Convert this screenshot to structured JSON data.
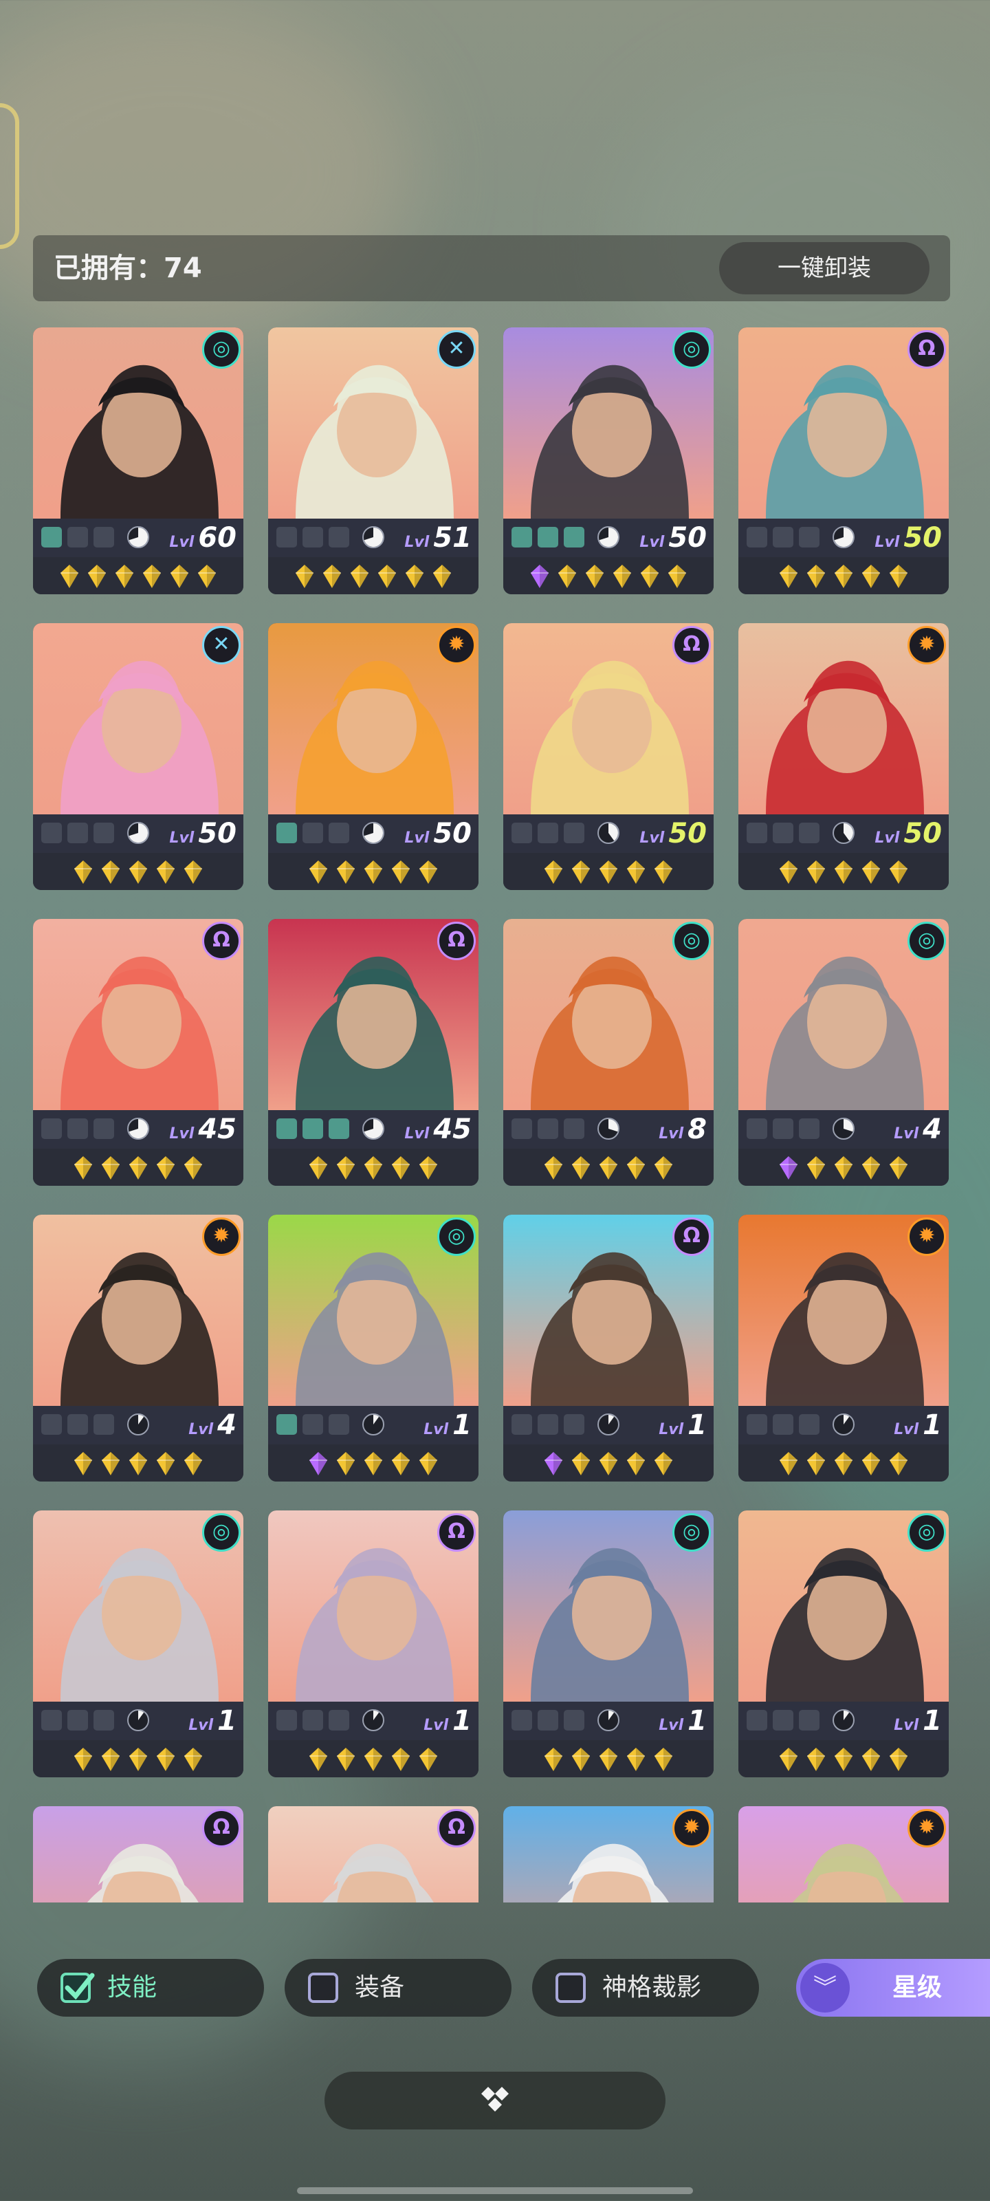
{
  "header": {
    "owned_label": "已拥有：74",
    "unequip_all": "一键卸装"
  },
  "colors": {
    "star_gold": "#f3c534",
    "star_purple": "#b86cff",
    "faction_teal": "#3fe0c8",
    "faction_purple": "#c58cff",
    "faction_orange": "#ff9c28",
    "faction_blue": "#7ad8f6"
  },
  "cards": [
    {
      "faction": "teal-swirl-icon",
      "level": "60",
      "slots_on": 1,
      "gear": 0.7,
      "stars": [
        "g",
        "g",
        "g",
        "g",
        "g",
        "g"
      ],
      "bg": "#e8a890",
      "art": "#1c1a1c"
    },
    {
      "faction": "blue-cross-icon",
      "level": "51",
      "slots_on": 0,
      "gear": 0.7,
      "stars": [
        "g",
        "g",
        "g",
        "g",
        "g",
        "g"
      ],
      "bg": "#f0c6a0",
      "art": "#e8ecd8"
    },
    {
      "faction": "teal-swirl-icon",
      "level": "50",
      "slots_on": 3,
      "gear": 0.7,
      "stars": [
        "p",
        "g",
        "g",
        "g",
        "g",
        "g"
      ],
      "bg": "#a88ce0",
      "art": "#3a3840"
    },
    {
      "faction": "purple-horn-icon",
      "level": "50",
      "slots_on": 0,
      "gear": 0.7,
      "stars": [
        "g",
        "g",
        "g",
        "g",
        "g"
      ],
      "bg": "#f0b08a",
      "art": "#5aa0a8",
      "max": true
    },
    {
      "faction": "blue-cross-icon",
      "level": "50",
      "slots_on": 0,
      "gear": 0.7,
      "stars": [
        "g",
        "g",
        "g",
        "g",
        "g"
      ],
      "bg": "#f2a890",
      "art": "#f0a0c8"
    },
    {
      "faction": "orange-gear-icon",
      "level": "50",
      "slots_on": 1,
      "gear": 0.7,
      "stars": [
        "g",
        "g",
        "g",
        "g",
        "g"
      ],
      "bg": "#e89a40",
      "art": "#f5a030"
    },
    {
      "faction": "purple-horn-icon",
      "level": "50",
      "slots_on": 0,
      "gear": 0.4,
      "stars": [
        "g",
        "g",
        "g",
        "g",
        "g"
      ],
      "bg": "#f2b890",
      "art": "#f0d888",
      "max": true
    },
    {
      "faction": "orange-gear-icon",
      "level": "50",
      "slots_on": 0,
      "gear": 0.4,
      "stars": [
        "g",
        "g",
        "g",
        "g",
        "g"
      ],
      "bg": "#e8c0a0",
      "art": "#c82a30",
      "max": true
    },
    {
      "faction": "purple-horn-icon",
      "level": "45",
      "slots_on": 0,
      "gear": 0.7,
      "stars": [
        "g",
        "g",
        "g",
        "g",
        "g"
      ],
      "bg": "#f2b0a0",
      "art": "#f06a5a"
    },
    {
      "faction": "purple-horn-icon",
      "level": "45",
      "slots_on": 3,
      "gear": 0.7,
      "stars": [
        "g",
        "g",
        "g",
        "g",
        "g"
      ],
      "bg": "#c83450",
      "art": "#2e5e5a"
    },
    {
      "faction": "teal-swirl-icon",
      "level": "8",
      "slots_on": 0,
      "gear": 0.3,
      "stars": [
        "g",
        "g",
        "g",
        "g",
        "g"
      ],
      "bg": "#e8b090",
      "art": "#d86a30"
    },
    {
      "faction": "teal-swirl-icon",
      "level": "4",
      "slots_on": 0,
      "gear": 0.3,
      "stars": [
        "p",
        "g",
        "g",
        "g",
        "g"
      ],
      "bg": "#f0a890",
      "art": "#8a8a90"
    },
    {
      "faction": "orange-gear-icon",
      "level": "4",
      "slots_on": 0,
      "gear": 0.1,
      "stars": [
        "g",
        "g",
        "g",
        "g",
        "g"
      ],
      "bg": "#f0c0a0",
      "art": "#2a2420"
    },
    {
      "faction": "teal-swirl-icon",
      "level": "1",
      "slots_on": 1,
      "gear": 0.1,
      "stars": [
        "p",
        "g",
        "g",
        "g",
        "g"
      ],
      "bg": "#9ad848",
      "art": "#8a8fa0"
    },
    {
      "faction": "purple-horn-icon",
      "level": "1",
      "slots_on": 0,
      "gear": 0.1,
      "stars": [
        "p",
        "g",
        "g",
        "g",
        "g"
      ],
      "bg": "#60d0e8",
      "art": "#4a3a30"
    },
    {
      "faction": "orange-gear-icon",
      "level": "1",
      "slots_on": 0,
      "gear": 0.1,
      "stars": [
        "g",
        "g",
        "g",
        "g",
        "g"
      ],
      "bg": "#e87830",
      "art": "#3a3030"
    },
    {
      "faction": "teal-swirl-icon",
      "level": "1",
      "slots_on": 0,
      "gear": 0.1,
      "stars": [
        "g",
        "g",
        "g",
        "g",
        "g"
      ],
      "bg": "#eec0b0",
      "art": "#c8c8d0"
    },
    {
      "faction": "purple-horn-icon",
      "level": "1",
      "slots_on": 0,
      "gear": 0.1,
      "stars": [
        "g",
        "g",
        "g",
        "g",
        "g"
      ],
      "bg": "#f0c8c0",
      "art": "#b8a8c8"
    },
    {
      "faction": "teal-swirl-icon",
      "level": "1",
      "slots_on": 0,
      "gear": 0.1,
      "stars": [
        "g",
        "g",
        "g",
        "g",
        "g"
      ],
      "bg": "#8a9ed8",
      "art": "#6a7ea0"
    },
    {
      "faction": "teal-swirl-icon",
      "level": "1",
      "slots_on": 0,
      "gear": 0.1,
      "stars": [
        "g",
        "g",
        "g",
        "g",
        "g"
      ],
      "bg": "#f0b890",
      "art": "#2a2a30"
    },
    {
      "faction": "purple-horn-icon",
      "level": "",
      "slots_on": 0,
      "gear": 0.1,
      "stars": [],
      "bg": "#c8a0e8",
      "art": "#e8e8e0"
    },
    {
      "faction": "purple-horn-icon",
      "level": "",
      "slots_on": 0,
      "gear": 0.1,
      "stars": [],
      "bg": "#f0d0c0",
      "art": "#d8d8d8"
    },
    {
      "faction": "orange-gear-icon",
      "level": "",
      "slots_on": 0,
      "gear": 0.1,
      "stars": [],
      "bg": "#60b0e8",
      "art": "#f0f0f0"
    },
    {
      "faction": "orange-gear-icon",
      "level": "",
      "slots_on": 0,
      "gear": 0.1,
      "stars": [],
      "bg": "#d8a0e8",
      "art": "#c8c890"
    }
  ],
  "lvl_tag": "Lvl",
  "filters": [
    {
      "label": "技能",
      "checked": true
    },
    {
      "label": "装备",
      "checked": false
    },
    {
      "label": "神格裁影",
      "checked": false
    }
  ],
  "sort": {
    "label": "星级",
    "icon": "double-chevron-down-icon"
  },
  "collapse": {
    "icon": "collapse-diamond-icon"
  }
}
